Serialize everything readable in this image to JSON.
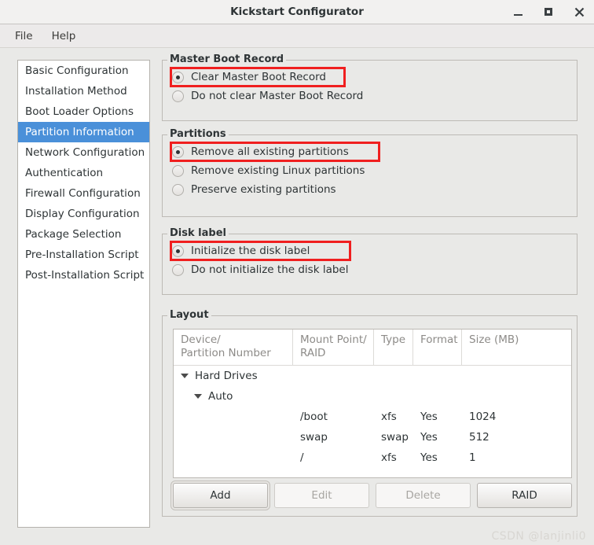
{
  "window": {
    "title": "Kickstart Configurator",
    "controls": [
      {
        "name": "minimize",
        "glyph": "_"
      },
      {
        "name": "maximize",
        "glyph": "□"
      },
      {
        "name": "close",
        "glyph": "✕"
      }
    ]
  },
  "menubar": {
    "items": [
      {
        "label": "File"
      },
      {
        "label": "Help"
      }
    ]
  },
  "sidebar": {
    "items": [
      {
        "label": "Basic Configuration",
        "selected": false
      },
      {
        "label": "Installation Method",
        "selected": false
      },
      {
        "label": "Boot Loader Options",
        "selected": false
      },
      {
        "label": "Partition Information",
        "selected": true
      },
      {
        "label": "Network Configuration",
        "selected": false
      },
      {
        "label": "Authentication",
        "selected": false
      },
      {
        "label": "Firewall Configuration",
        "selected": false
      },
      {
        "label": "Display Configuration",
        "selected": false
      },
      {
        "label": "Package Selection",
        "selected": false
      },
      {
        "label": "Pre-Installation Script",
        "selected": false
      },
      {
        "label": "Post-Installation Script",
        "selected": false
      }
    ]
  },
  "mbr_group": {
    "title": "Master Boot Record",
    "options": [
      {
        "label": "Clear Master Boot Record",
        "checked": true,
        "annotated": true
      },
      {
        "label": "Do not clear Master Boot Record",
        "checked": false,
        "annotated": false
      }
    ]
  },
  "partitions_group": {
    "title": "Partitions",
    "options": [
      {
        "label": "Remove all existing partitions",
        "checked": true,
        "annotated": true
      },
      {
        "label": "Remove existing Linux partitions",
        "checked": false,
        "annotated": false
      },
      {
        "label": "Preserve existing partitions",
        "checked": false,
        "annotated": false
      }
    ]
  },
  "disklabel_group": {
    "title": "Disk label",
    "options": [
      {
        "label": "Initialize the disk label",
        "checked": true,
        "annotated": true
      },
      {
        "label": "Do not initialize the disk label",
        "checked": false,
        "annotated": false
      }
    ]
  },
  "layout_group": {
    "title": "Layout",
    "columns": [
      "Device/\nPartition Number",
      "Mount Point/\nRAID",
      "Type",
      "Format",
      "Size (MB)"
    ],
    "tree": [
      {
        "level": 1,
        "expander": true,
        "device": "Hard Drives",
        "mount": "",
        "type": "",
        "format": "",
        "size": ""
      },
      {
        "level": 2,
        "expander": true,
        "device": "Auto",
        "mount": "",
        "type": "",
        "format": "",
        "size": ""
      },
      {
        "level": 3,
        "expander": false,
        "device": "",
        "mount": "/boot",
        "type": "xfs",
        "format": "Yes",
        "size": "1024"
      },
      {
        "level": 3,
        "expander": false,
        "device": "",
        "mount": "swap",
        "type": "swap",
        "format": "Yes",
        "size": "512"
      },
      {
        "level": 3,
        "expander": false,
        "device": "",
        "mount": "/",
        "type": "xfs",
        "format": "Yes",
        "size": "1"
      }
    ],
    "buttons": [
      {
        "label": "Add",
        "state": "focused"
      },
      {
        "label": "Edit",
        "state": "disabled"
      },
      {
        "label": "Delete",
        "state": "disabled"
      },
      {
        "label": "RAID",
        "state": "normal"
      }
    ]
  },
  "watermark": {
    "text": "CSDN @lanjinli0"
  },
  "colors": {
    "selection": "#4a90d9",
    "annotation": "#f01f1f",
    "window_bg": "#e9e9e7",
    "panel_bg": "#ffffff",
    "border": "#bdbab5"
  }
}
